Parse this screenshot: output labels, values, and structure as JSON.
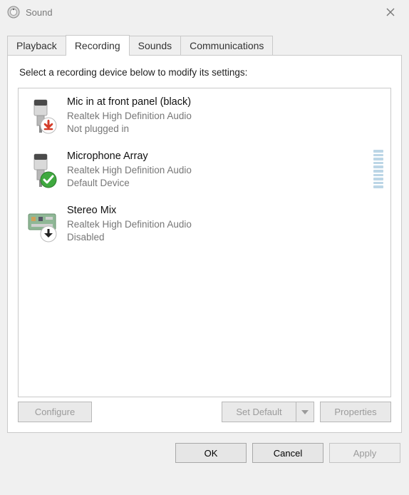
{
  "window": {
    "title": "Sound"
  },
  "tabs": {
    "playback": "Playback",
    "recording": "Recording",
    "sounds": "Sounds",
    "communications": "Communications",
    "active": "recording"
  },
  "panel": {
    "instruction": "Select a recording device below to modify its settings:"
  },
  "devices": [
    {
      "name": "Mic in at front panel (black)",
      "driver": "Realtek High Definition Audio",
      "status": "Not plugged in",
      "icon": "mic-jack",
      "overlay": "down-red",
      "show_level": false
    },
    {
      "name": "Microphone Array",
      "driver": "Realtek High Definition Audio",
      "status": "Default Device",
      "icon": "mic-jack",
      "overlay": "check-green",
      "show_level": true
    },
    {
      "name": "Stereo Mix",
      "driver": "Realtek High Definition Audio",
      "status": "Disabled",
      "icon": "sound-card",
      "overlay": "down-black",
      "show_level": false
    }
  ],
  "buttons": {
    "configure": "Configure",
    "set_default": "Set Default",
    "properties": "Properties",
    "ok": "OK",
    "cancel": "Cancel",
    "apply": "Apply"
  }
}
